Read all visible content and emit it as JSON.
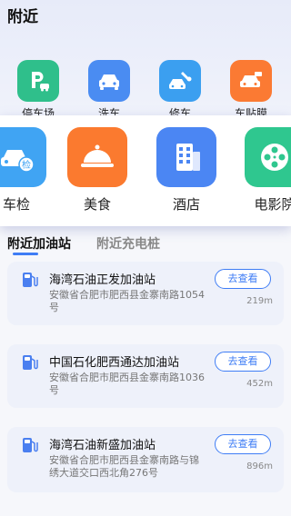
{
  "header": {
    "title": "附近"
  },
  "categories_small": [
    {
      "label": "停车场",
      "icon": "parking-icon",
      "color": "#2fbf8b"
    },
    {
      "label": "洗车",
      "icon": "car-wash-icon",
      "color": "#4a8cf2"
    },
    {
      "label": "修车",
      "icon": "car-repair-icon",
      "color": "#3b9ff0"
    },
    {
      "label": "车贴膜",
      "icon": "car-film-icon",
      "color": "#fb7a33"
    }
  ],
  "categories_big": [
    {
      "label": "车检",
      "icon": "car-inspection-icon",
      "badge": "检",
      "color": "#40a4f3"
    },
    {
      "label": "美食",
      "icon": "food-icon",
      "color": "#fb7a2f"
    },
    {
      "label": "酒店",
      "icon": "hotel-icon",
      "color": "#4b86f3"
    },
    {
      "label": "电影院",
      "icon": "cinema-icon",
      "color": "#2fc78f"
    }
  ],
  "tabs": [
    {
      "label": "附近加油站",
      "active": true
    },
    {
      "label": "附近充电桩",
      "active": false
    }
  ],
  "stations": [
    {
      "name": "海湾石油正发加油站",
      "address": "安徽省合肥市肥西县金寨南路1054号",
      "distance": "219m",
      "action": "去查看"
    },
    {
      "name": "中国石化肥西通达加油站",
      "address": "安徽省合肥市肥西县金寨南路1036号",
      "distance": "452m",
      "action": "去查看"
    },
    {
      "name": "海湾石油新盛加油站",
      "address": "安徽省合肥市肥西县金寨南路与锦绣大道交口西北角276号",
      "distance": "896m",
      "action": "去查看"
    }
  ],
  "colors": {
    "accent": "#3f7df5",
    "card_bg": "#eef1fa",
    "fuel_icon": "#4a7ff0"
  }
}
